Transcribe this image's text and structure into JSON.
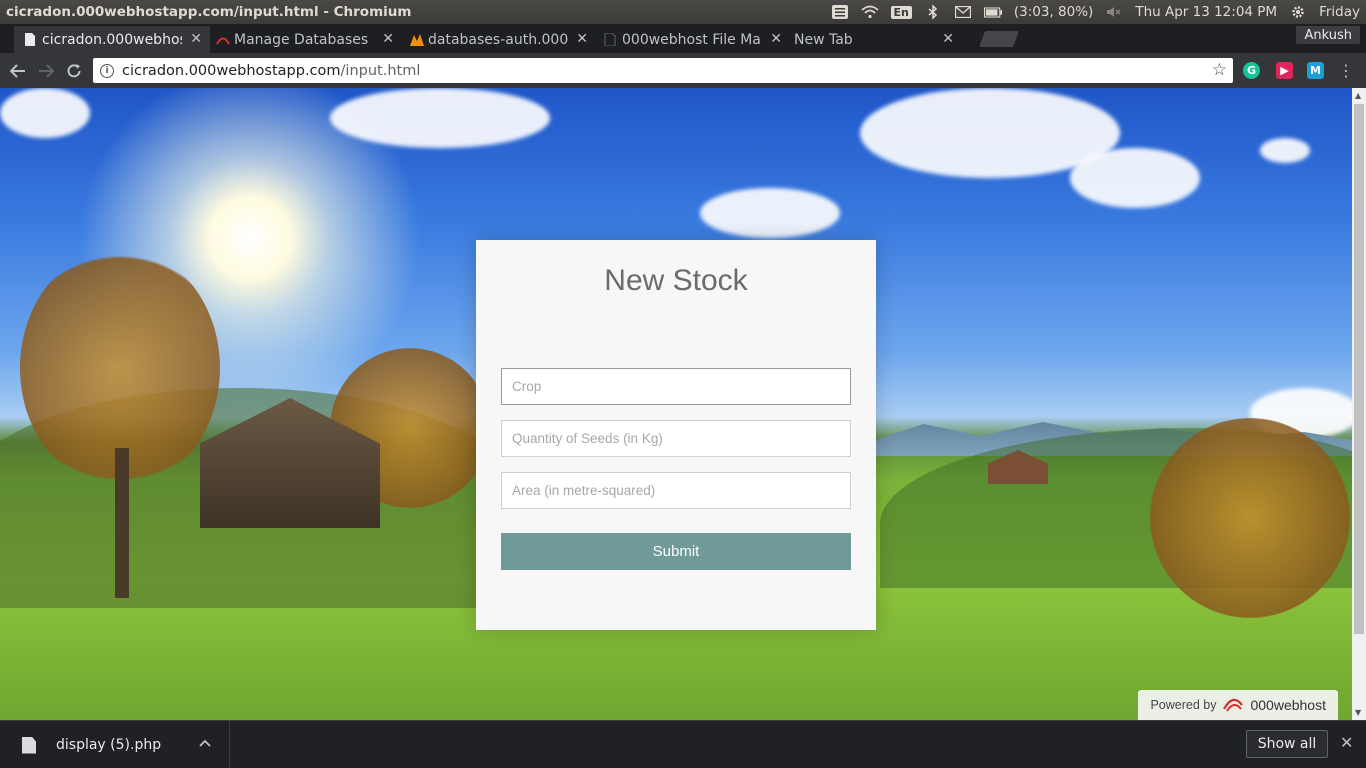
{
  "os": {
    "window_title": "cicradon.000webhostapp.com/input.html - Chromium",
    "lang": "En",
    "battery": "(3:03, 80%)",
    "datetime": "Thu Apr 13 12:04 PM",
    "user_day": "Friday"
  },
  "browser": {
    "tabs": [
      {
        "label": "cicradon.000webhos",
        "active": true
      },
      {
        "label": "Manage Databases",
        "active": false
      },
      {
        "label": "databases-auth.000w",
        "active": false
      },
      {
        "label": "000webhost File Ma",
        "active": false
      },
      {
        "label": "New Tab",
        "active": false
      }
    ],
    "profile": "Ankush",
    "url_host": "cicradon.000webhostapp.com",
    "url_path": "/input.html"
  },
  "page": {
    "title": "New Stock",
    "fields": [
      {
        "placeholder": "Crop",
        "value": ""
      },
      {
        "placeholder": "Quantity of Seeds (in Kg)",
        "value": ""
      },
      {
        "placeholder": "Area (in metre-squared)",
        "value": ""
      }
    ],
    "submit_label": "Submit",
    "powered_by": "Powered by",
    "powered_brand": "000webhost",
    "accent_color": "#6f9a98"
  },
  "downloads": {
    "item": "display (5).php",
    "show_all": "Show all"
  }
}
